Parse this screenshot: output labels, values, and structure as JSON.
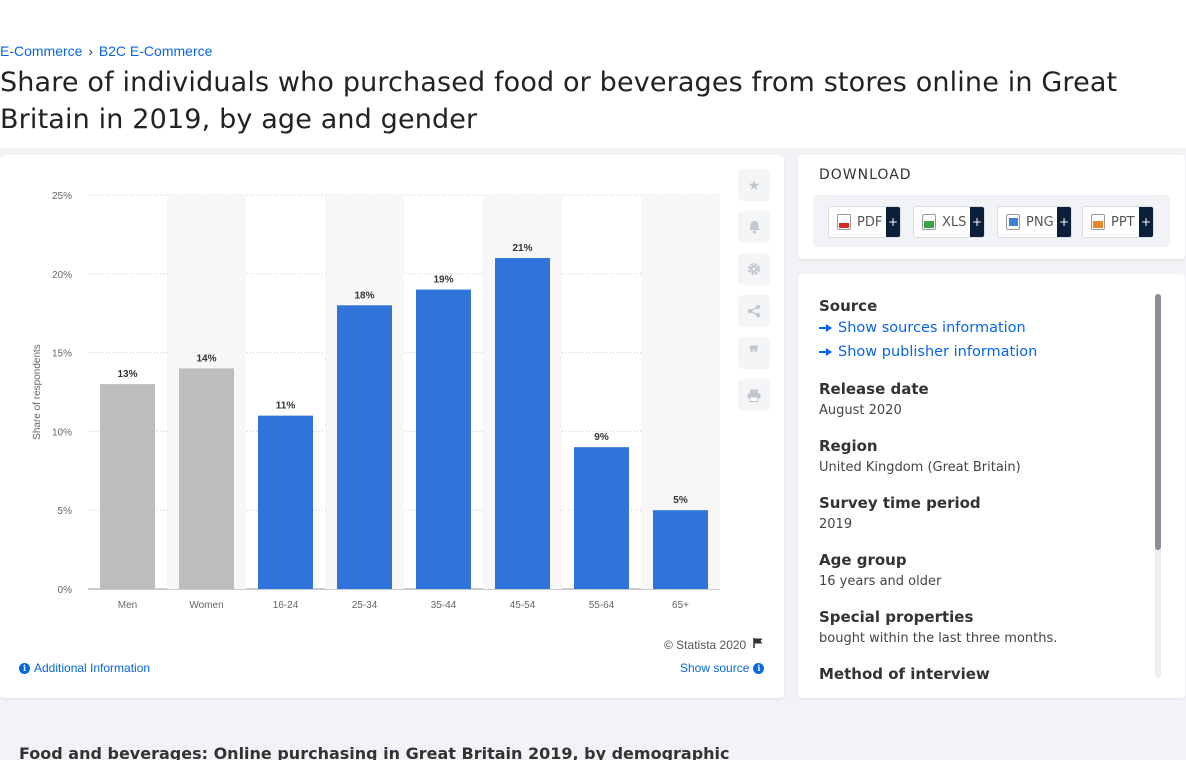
{
  "breadcrumb": [
    "E-Commerce",
    "B2C E-Commerce"
  ],
  "title": "Share of individuals who purchased food or beverages from stores online in Great Britain in 2019, by age and gender",
  "chart_data": {
    "type": "bar",
    "categories": [
      "Men",
      "Women",
      "16-24",
      "25-34",
      "35-44",
      "45-54",
      "55-64",
      "65+"
    ],
    "values": [
      13,
      14,
      11,
      18,
      19,
      21,
      9,
      5
    ],
    "data_labels": [
      "13%",
      "14%",
      "11%",
      "18%",
      "19%",
      "21%",
      "9%",
      "5%"
    ],
    "bar_colors": [
      "#bdbdbd",
      "#bdbdbd",
      "#3073d9",
      "#3073d9",
      "#3073d9",
      "#3073d9",
      "#3073d9",
      "#3073d9"
    ],
    "ylabel": "Share of respondents",
    "ylim": [
      0,
      25
    ],
    "yticks": [
      "0%",
      "5%",
      "10%",
      "15%",
      "20%",
      "25%"
    ],
    "grid": true
  },
  "chart_footer": {
    "copyright": "© Statista 2020",
    "additional_info": "Additional Information",
    "show_source": "Show source"
  },
  "download": {
    "title": "DOWNLOAD",
    "formats": [
      "PDF",
      "XLS",
      "PNG",
      "PPT"
    ],
    "plus": "+"
  },
  "info": {
    "source_label": "Source",
    "show_sources": "Show sources information",
    "show_publisher": "Show publisher information",
    "release_date_label": "Release date",
    "release_date": "August 2020",
    "region_label": "Region",
    "region": "United Kingdom (Great Britain)",
    "survey_period_label": "Survey time period",
    "survey_period": "2019",
    "age_group_label": "Age group",
    "age_group": "16 years and older",
    "special_label": "Special properties",
    "special": "bought within the last three months.",
    "method_label": "Method of interview"
  },
  "bottom_title": "Food and beverages: Online purchasing in Great Britain 2019, by demographic",
  "colors": {
    "accent": "#0666e5",
    "bar_blue": "#3073d9",
    "bar_grey": "#bdbdbd"
  },
  "icons": [
    "star-icon",
    "bell-icon",
    "gear-icon",
    "share-icon",
    "quote-icon",
    "print-icon",
    "flag-icon",
    "info-icon",
    "arrow-right-icon"
  ]
}
